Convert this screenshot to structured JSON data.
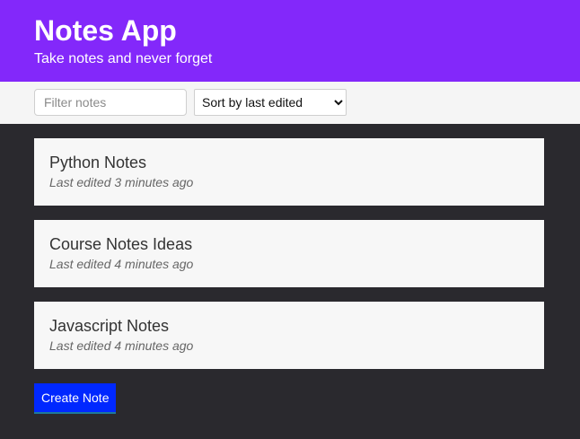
{
  "header": {
    "title": "Notes App",
    "subtitle": "Take notes and never forget"
  },
  "toolbar": {
    "filter_placeholder": "Filter notes",
    "sort_selected": "Sort by last edited",
    "sort_options": [
      "Sort by last edited"
    ]
  },
  "notes": [
    {
      "title": "Python Notes",
      "meta": "Last edited 3 minutes ago"
    },
    {
      "title": "Course Notes Ideas",
      "meta": "Last edited 4 minutes ago"
    },
    {
      "title": "Javascript Notes",
      "meta": "Last edited 4 minutes ago"
    }
  ],
  "actions": {
    "create_label": "Create Note"
  },
  "colors": {
    "header_bg": "#8328fa",
    "page_bg": "#2a292e",
    "button_bg": "#0028ff"
  }
}
